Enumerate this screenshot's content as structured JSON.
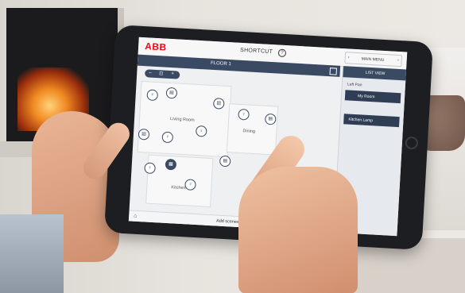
{
  "app": {
    "logo": "ABB",
    "title": "SHORTCUT",
    "help_icon": "?",
    "nav": {
      "left": "‹",
      "label": "MAIN MENU",
      "right": "›"
    }
  },
  "floorbar": {
    "label": "FLOOR 1"
  },
  "toolpill": {
    "items": [
      "←",
      "⊡",
      "+"
    ]
  },
  "rooms": {
    "living": "Living Room",
    "dining": "Dining",
    "kitchen": "Kitchen"
  },
  "sidebar": {
    "header": "LIST VIEW",
    "subheader": "Left Pan",
    "items": [
      "My Room",
      "Kitchen Lamp"
    ]
  },
  "bottombar": {
    "text": "Add scenes and groups"
  },
  "colors": {
    "accent": "#3a4a63",
    "brand": "#ff000f"
  }
}
